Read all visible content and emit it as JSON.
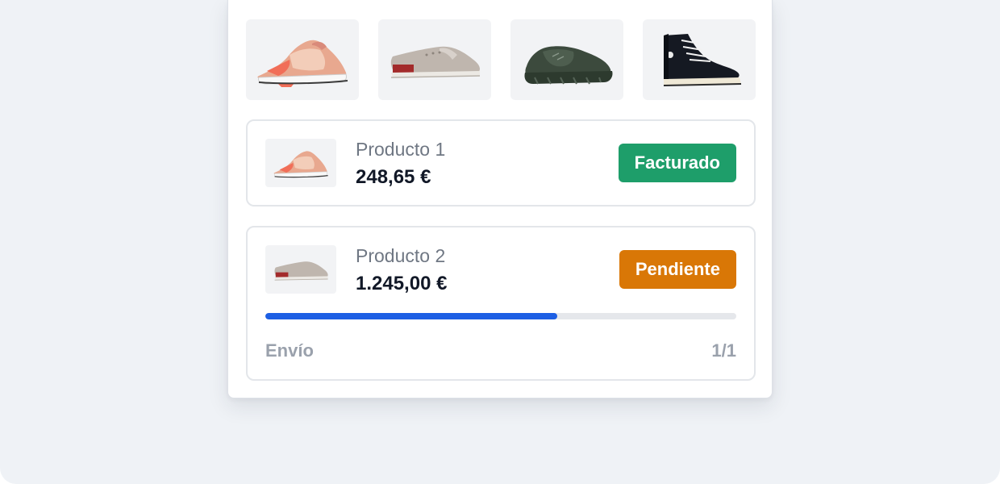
{
  "gallery": [
    {
      "icon": "pink-sneaker-icon"
    },
    {
      "icon": "grey-canvas-shoe-icon"
    },
    {
      "icon": "dark-green-running-shoe-icon"
    },
    {
      "icon": "black-high-top-sneaker-icon"
    }
  ],
  "items": [
    {
      "name": "Producto 1",
      "price": "248,65 €",
      "status": "Facturado",
      "status_color": "#1e9e6a",
      "thumb_icon": "pink-sneaker-icon"
    },
    {
      "name": "Producto 2",
      "price": "1.245,00 €",
      "status": "Pendiente",
      "status_color": "#d97706",
      "thumb_icon": "grey-canvas-shoe-icon",
      "shipping": {
        "label": "Envío",
        "count": "1/1",
        "progress": 0.62
      }
    }
  ],
  "colors": {
    "progress": "#1d5fe4",
    "background": "#eff2f6"
  }
}
